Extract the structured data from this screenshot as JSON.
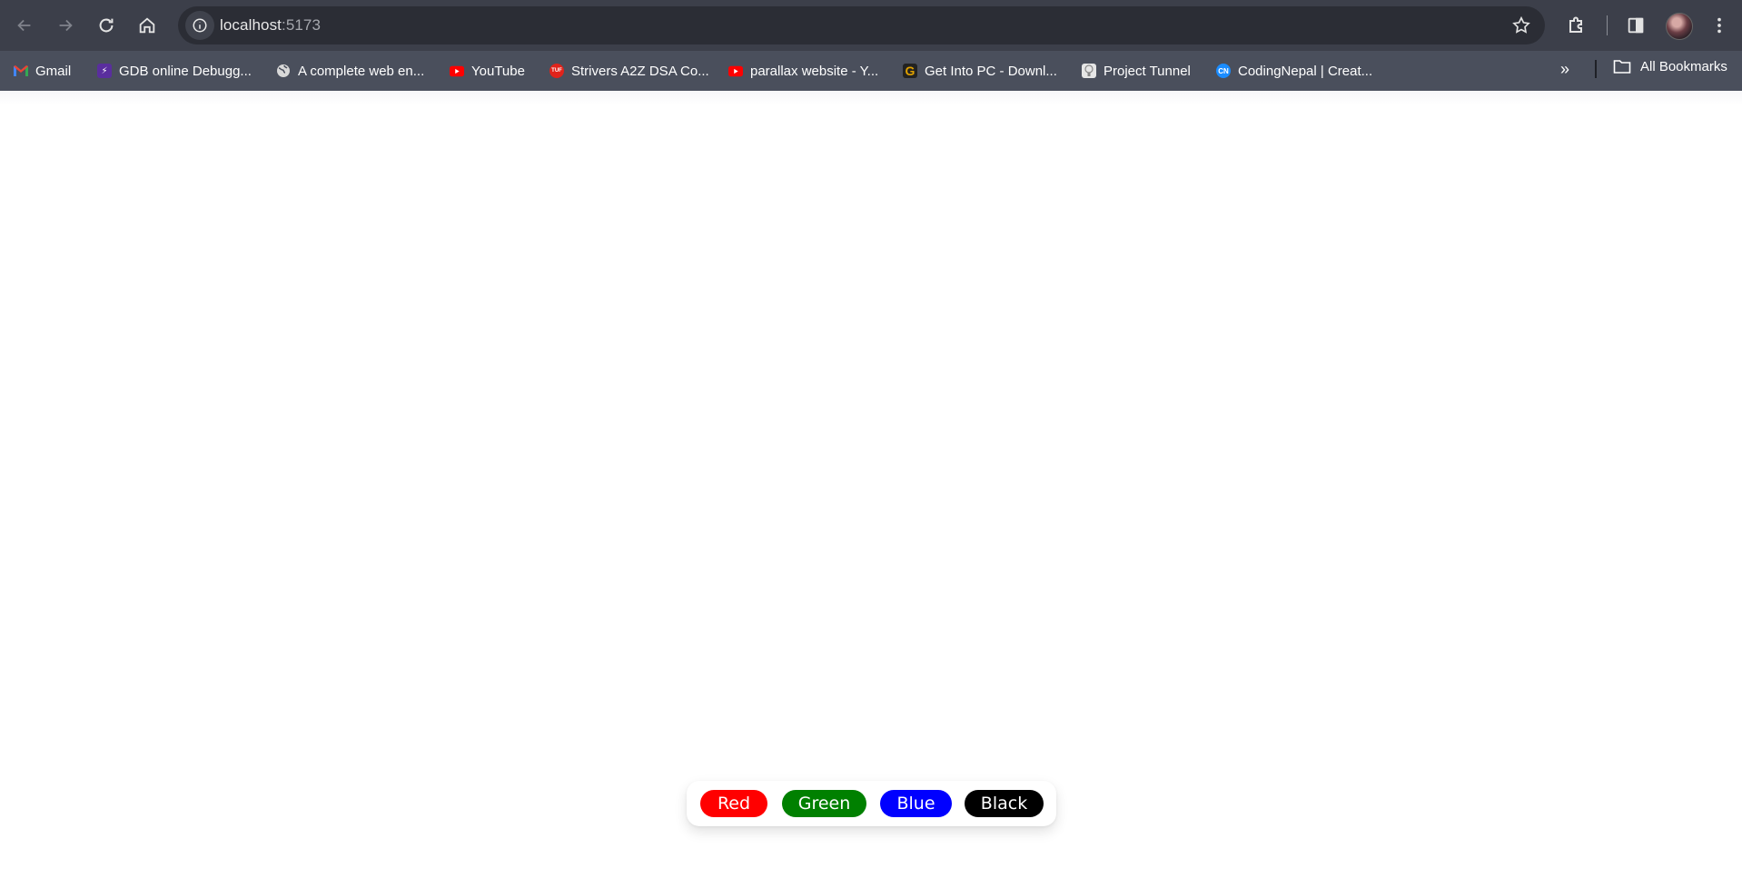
{
  "browser": {
    "url_host": "localhost",
    "url_port": ":5173",
    "bookmarks": [
      {
        "label": "Gmail",
        "icon": "gmail-icon",
        "color": "#ea4335"
      },
      {
        "label": "GDB online Debugg...",
        "icon": "gdb-icon",
        "color": "#6a3fb5"
      },
      {
        "label": "A complete web en...",
        "icon": "globe-icon",
        "color": "#d0d0d0"
      },
      {
        "label": "YouTube",
        "icon": "youtube-icon",
        "color": "#ff0000"
      },
      {
        "label": "Strivers A2Z DSA Co...",
        "icon": "tuf-icon",
        "color": "#e0231b"
      },
      {
        "label": "parallax website - Y...",
        "icon": "youtube-icon",
        "color": "#ff0000"
      },
      {
        "label": "Get Into PC - Downl...",
        "icon": "getintopc-icon",
        "color": "#e0a100"
      },
      {
        "label": "Project Tunnel",
        "icon": "project-tunnel-icon",
        "color": "#e6e6e6"
      },
      {
        "label": "CodingNepal | Creat...",
        "icon": "codingnepal-icon",
        "color": "#1a8cff"
      }
    ],
    "all_bookmarks_label": "All Bookmarks"
  },
  "page": {
    "background": "#ffffff",
    "color_buttons": [
      {
        "label": "Red",
        "color": "#ff0000"
      },
      {
        "label": "Green",
        "color": "#008000"
      },
      {
        "label": "Blue",
        "color": "#0000ff"
      },
      {
        "label": "Black",
        "color": "#000000"
      }
    ]
  }
}
